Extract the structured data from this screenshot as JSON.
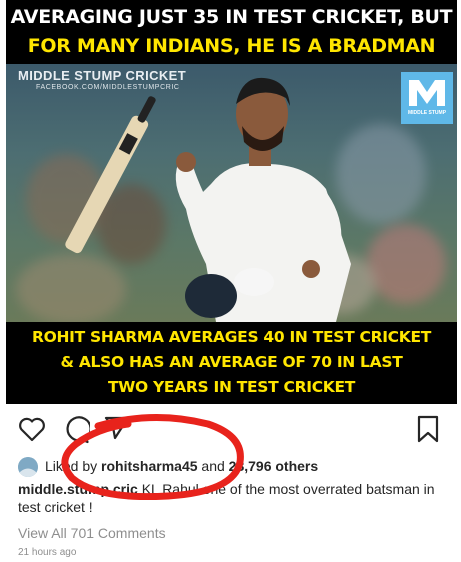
{
  "meme": {
    "headline_line1": "AVERAGING JUST 35 IN TEST CRICKET, BUT",
    "headline_line2": "FOR MANY INDIANS, HE IS A BRADMAN",
    "watermark": "MIDDLE STUMP CRICKET",
    "watermark_sub": "FACEBOOK.COM/MIDDLESTUMPCRIC",
    "logo_text": "MIDDLE STUMP",
    "bottom_line1": "ROHIT SHARMA AVERAGES 40 IN TEST CRICKET",
    "bottom_line2": "& ALSO HAS AN AVERAGE OF 70 IN LAST",
    "bottom_line3": "TWO YEARS IN TEST CRICKET",
    "colors": {
      "headline": "#ffffff",
      "highlight": "#ffe600",
      "logo": "#5fb8e8"
    }
  },
  "actions": {
    "like_icon": "heart-icon",
    "comment_icon": "comment-icon",
    "share_icon": "share-icon",
    "save_icon": "bookmark-icon"
  },
  "likes": {
    "prefix": "Liked by ",
    "username": "rohitsharma45",
    "middle": " and ",
    "others": "28,796 others"
  },
  "caption": {
    "username": "middle.stump.cric",
    "text": " KL Rahul one of the most overrated batsman in test cricket !"
  },
  "view_all": "View All 701 Comments",
  "timestamp": "21 hours ago",
  "annotation_color": "#e8231c"
}
